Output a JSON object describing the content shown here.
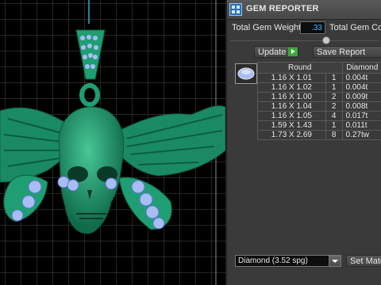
{
  "panel": {
    "title": "GEM REPORTER",
    "total_weight_label": "Total Gem Weight",
    "total_weight_value": ".33",
    "total_count_label": "Total Gem Cou",
    "update_label": "Update",
    "save_report_label": "Save Report",
    "table": {
      "headers": [
        "Round",
        "Diamond"
      ],
      "rows": [
        {
          "size": "1.16 X 1.01",
          "count": "1",
          "weight": "0.004t"
        },
        {
          "size": "1.16 X 1.02",
          "count": "1",
          "weight": "0.004t"
        },
        {
          "size": "1.16 X 1.00",
          "count": "2",
          "weight": "0.009t"
        },
        {
          "size": "1.16 X 1.04",
          "count": "2",
          "weight": "0.008t"
        },
        {
          "size": "1.16 X 1.05",
          "count": "4",
          "weight": "0.017t"
        },
        {
          "size": "1.59 X 1.43",
          "count": "1",
          "weight": "0.011t"
        },
        {
          "size": "1.73 X 2.69",
          "count": "8",
          "weight": "0.27tw"
        }
      ]
    },
    "material_select": "Diamond     (3.52 spg)",
    "set_material_label": "Set Mater"
  },
  "colors": {
    "model": "#1f9e73",
    "gems": "#a9bdf3",
    "grid": "#4a4a4a"
  }
}
